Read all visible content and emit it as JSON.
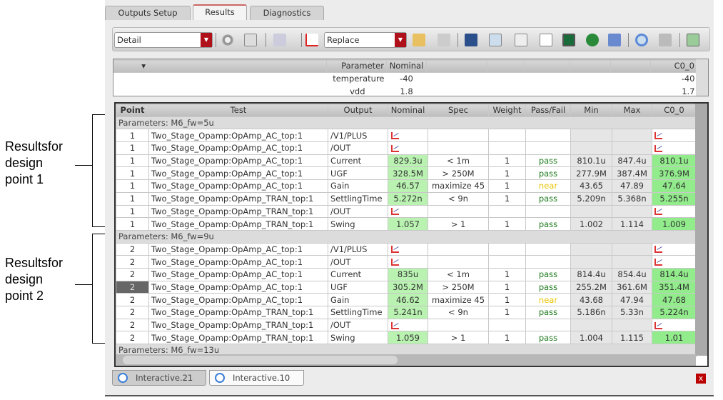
{
  "annotations": [
    {
      "lines": [
        "Resultsfor",
        "design",
        "point 1"
      ]
    },
    {
      "lines": [
        "Resultsfor",
        "design",
        "point 2"
      ]
    }
  ],
  "tabs": [
    {
      "label": "Outputs Setup"
    },
    {
      "label": "Results",
      "active": true
    },
    {
      "label": "Diagnostics"
    }
  ],
  "toolbar": {
    "view_select": "Detail",
    "mode_select": "Replace"
  },
  "param_table": {
    "headers": [
      "Parameter",
      "Nominal",
      "C0_0"
    ],
    "rows": [
      {
        "name": "temperature",
        "nominal": "-40",
        "c0": "-40"
      },
      {
        "name": "vdd",
        "nominal": "1.8",
        "c0": "1.7"
      }
    ]
  },
  "results_table": {
    "headers": [
      "Point",
      "Test",
      "Output",
      "Nominal",
      "Spec",
      "Weight",
      "Pass/Fail",
      "Min",
      "Max",
      "C0_0"
    ],
    "groups": [
      {
        "label": "Parameters: M6_fw=5u",
        "rows": [
          [
            "1",
            "Two_Stage_Opamp:OpAmp_AC_top:1",
            "/V1/PLUS",
            "#plot",
            "",
            "",
            "",
            "",
            "",
            "#plot"
          ],
          [
            "1",
            "Two_Stage_Opamp:OpAmp_AC_top:1",
            "/OUT",
            "#plot",
            "",
            "",
            "",
            "",
            "",
            "#plot"
          ],
          [
            "1",
            "Two_Stage_Opamp:OpAmp_AC_top:1",
            "Current",
            "829.3u",
            "< 1m",
            "1",
            "pass",
            "810.1u",
            "847.4u",
            "810.1u"
          ],
          [
            "1",
            "Two_Stage_Opamp:OpAmp_AC_top:1",
            "UGF",
            "328.5M",
            "> 250M",
            "1",
            "pass",
            "277.9M",
            "387.4M",
            "376.9M"
          ],
          [
            "1",
            "Two_Stage_Opamp:OpAmp_AC_top:1",
            "Gain",
            "46.57",
            "maximize 45",
            "1",
            "near",
            "43.65",
            "47.89",
            "47.64"
          ],
          [
            "1",
            "Two_Stage_Opamp:OpAmp_TRAN_top:1",
            "SettlingTime",
            "5.272n",
            "< 9n",
            "1",
            "pass",
            "5.209n",
            "5.368n",
            "5.255n"
          ],
          [
            "1",
            "Two_Stage_Opamp:OpAmp_TRAN_top:1",
            "/OUT",
            "#plot",
            "",
            "",
            "",
            "",
            "",
            "#plot"
          ],
          [
            "1",
            "Two_Stage_Opamp:OpAmp_TRAN_top:1",
            "Swing",
            "1.057",
            "> 1",
            "1",
            "pass",
            "1.002",
            "1.114",
            "1.009"
          ]
        ]
      },
      {
        "label": "Parameters: M6_fw=9u",
        "rows": [
          [
            "2",
            "Two_Stage_Opamp:OpAmp_AC_top:1",
            "/V1/PLUS",
            "#plot",
            "",
            "",
            "",
            "",
            "",
            "#plot"
          ],
          [
            "2",
            "Two_Stage_Opamp:OpAmp_AC_top:1",
            "/OUT",
            "#plot",
            "",
            "",
            "",
            "",
            "",
            "#plot"
          ],
          [
            "2",
            "Two_Stage_Opamp:OpAmp_AC_top:1",
            "Current",
            "835u",
            "< 1m",
            "1",
            "pass",
            "814.4u",
            "854.4u",
            "814.4u"
          ],
          [
            "2",
            "Two_Stage_Opamp:OpAmp_AC_top:1",
            "UGF",
            "305.2M",
            "> 250M",
            "1",
            "pass",
            "255.2M",
            "361.6M",
            "351.4M"
          ],
          [
            "2",
            "Two_Stage_Opamp:OpAmp_AC_top:1",
            "Gain",
            "46.62",
            "maximize 45",
            "1",
            "near",
            "43.68",
            "47.94",
            "47.68"
          ],
          [
            "2",
            "Two_Stage_Opamp:OpAmp_TRAN_top:1",
            "SettlingTime",
            "5.241n",
            "< 9n",
            "1",
            "pass",
            "5.186n",
            "5.33n",
            "5.224n"
          ],
          [
            "2",
            "Two_Stage_Opamp:OpAmp_TRAN_top:1",
            "/OUT",
            "#plot",
            "",
            "",
            "",
            "",
            "",
            "#plot"
          ],
          [
            "2",
            "Two_Stage_Opamp:OpAmp_TRAN_top:1",
            "Swing",
            "1.059",
            "> 1",
            "1",
            "pass",
            "1.004",
            "1.115",
            "1.01"
          ]
        ]
      },
      {
        "label": "Parameters: M6_fw=13u",
        "rows": []
      }
    ]
  },
  "bottom_tabs": [
    {
      "label": "Interactive.21"
    },
    {
      "label": "Interactive.10",
      "active": true
    }
  ],
  "colors": {
    "pass": "#1c7a1c",
    "near": "#e8c400",
    "nominal_bg": "#b9f2b1",
    "c0_bg": "#92ec8c"
  }
}
